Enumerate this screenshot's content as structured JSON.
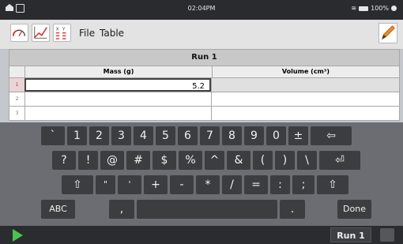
{
  "status": {
    "time": "02:04PM",
    "battery": "100%"
  },
  "toolbar": {
    "menu_file": "File",
    "menu_table": "Table"
  },
  "table": {
    "title": "Run 1",
    "columns": [
      "Mass (g)",
      "Volume (cm³)"
    ],
    "rows": [
      {
        "n": "1",
        "mass": "5.2",
        "volume": ""
      },
      {
        "n": "2",
        "mass": "",
        "volume": ""
      },
      {
        "n": "3",
        "mass": "",
        "volume": ""
      }
    ]
  },
  "keyboard": {
    "row1": [
      "`",
      "1",
      "2",
      "3",
      "4",
      "5",
      "6",
      "7",
      "8",
      "9",
      "0",
      "±",
      "⇦"
    ],
    "row2": [
      "?",
      "!",
      "@",
      "#",
      "$",
      "%",
      "^",
      "&",
      "(",
      ")",
      "\\",
      "⏎"
    ],
    "row3": [
      "⇧",
      "\"",
      "'",
      "+",
      "-",
      "*",
      "/",
      "=",
      ":",
      ";",
      "⇧"
    ],
    "row4": [
      "ABC",
      ",",
      "",
      ".",
      "Done"
    ]
  },
  "bottom": {
    "run_label": "Run 1"
  },
  "colors": {
    "accent_green": "#4bc24b",
    "accent_red": "#c0392b",
    "pencil_orange": "#f28c28"
  }
}
